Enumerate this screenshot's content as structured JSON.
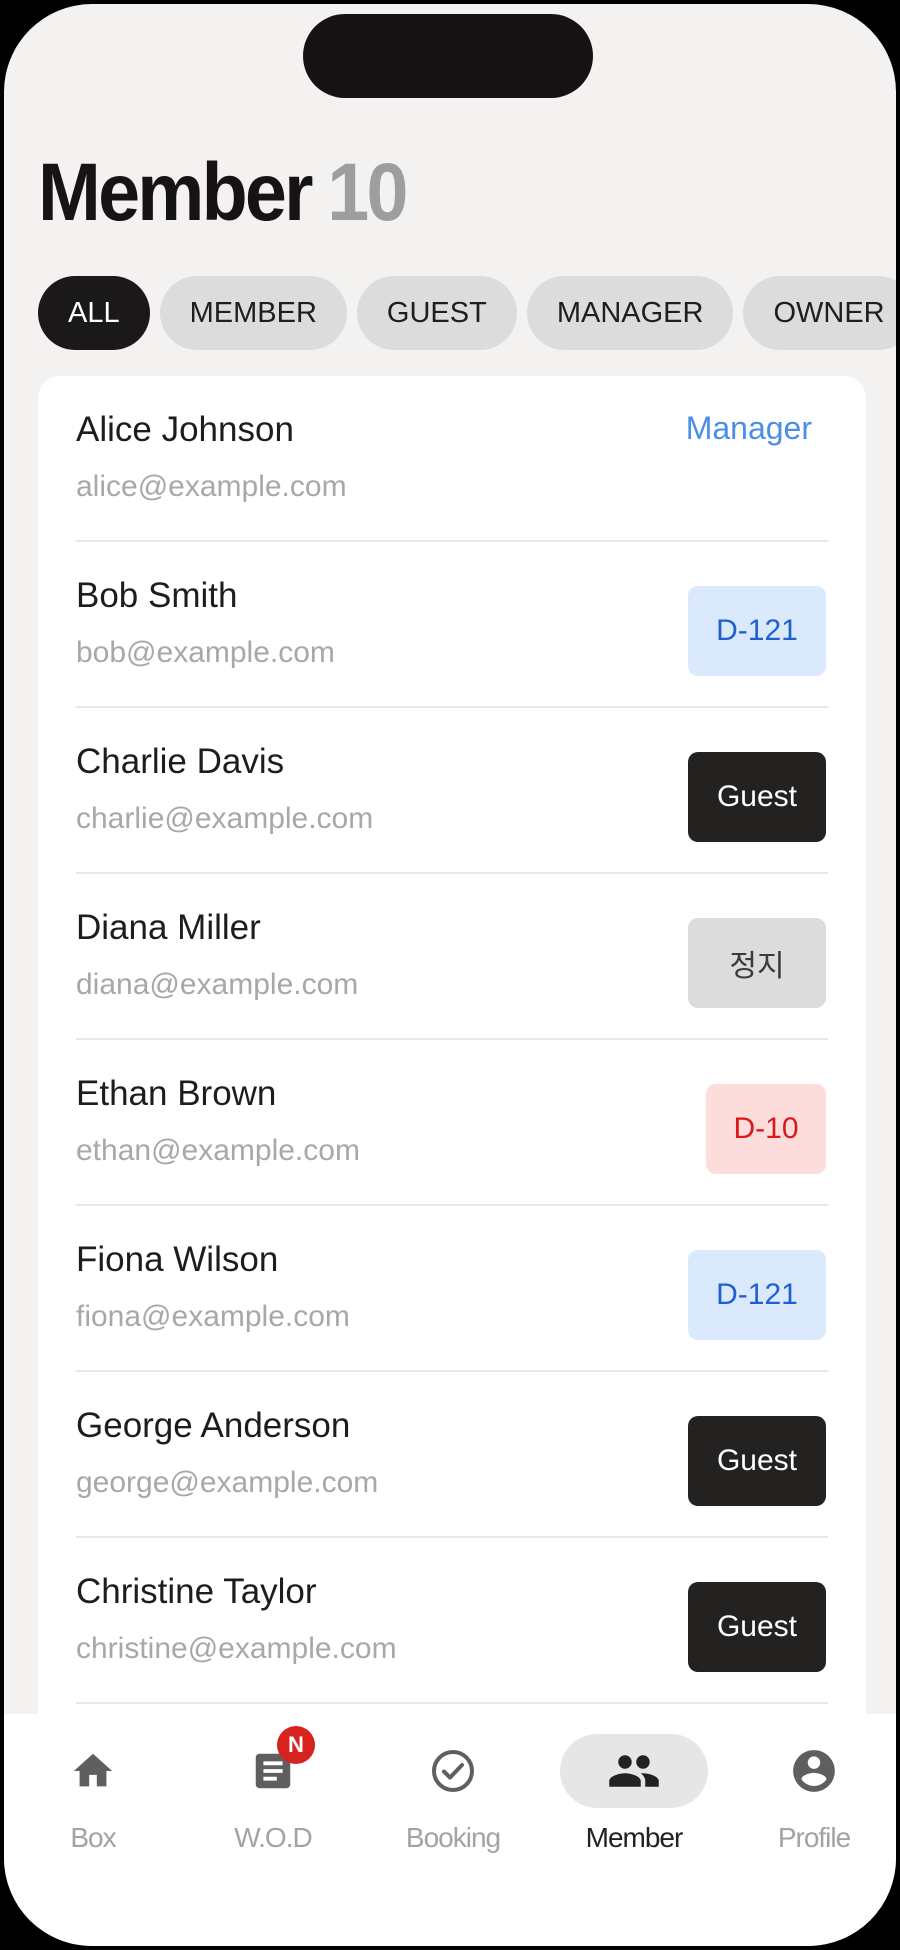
{
  "header": {
    "title": "Member",
    "count": "10"
  },
  "tabs": [
    {
      "label": "ALL",
      "active": true
    },
    {
      "label": "MEMBER",
      "active": false
    },
    {
      "label": "GUEST",
      "active": false
    },
    {
      "label": "MANAGER",
      "active": false
    },
    {
      "label": "OWNER",
      "active": false
    }
  ],
  "members": [
    {
      "name": "Alice Johnson",
      "email": "alice@example.com",
      "badge": "Manager",
      "badge_style": "role"
    },
    {
      "name": "Bob Smith",
      "email": "bob@example.com",
      "badge": "D-121",
      "badge_style": "blue"
    },
    {
      "name": "Charlie Davis",
      "email": "charlie@example.com",
      "badge": "Guest",
      "badge_style": "dark"
    },
    {
      "name": "Diana Miller",
      "email": "diana@example.com",
      "badge": "정지",
      "badge_style": "gray"
    },
    {
      "name": "Ethan Brown",
      "email": "ethan@example.com",
      "badge": "D-10",
      "badge_style": "red"
    },
    {
      "name": "Fiona Wilson",
      "email": "fiona@example.com",
      "badge": "D-121",
      "badge_style": "blue"
    },
    {
      "name": "George Anderson",
      "email": "george@example.com",
      "badge": "Guest",
      "badge_style": "dark"
    },
    {
      "name": "Christine Taylor",
      "email": "christine@example.com",
      "badge": "Guest",
      "badge_style": "dark"
    }
  ],
  "bottom_nav": {
    "items": [
      {
        "label": "Box",
        "icon": "home-icon",
        "active": false
      },
      {
        "label": "W.O.D",
        "icon": "article-icon",
        "active": false,
        "badge": "N"
      },
      {
        "label": "Booking",
        "icon": "check-circle-icon",
        "active": false
      },
      {
        "label": "Member",
        "icon": "people-icon",
        "active": true
      },
      {
        "label": "Profile",
        "icon": "account-circle-icon",
        "active": false
      }
    ]
  },
  "colors": {
    "background": "#f3f2f0",
    "accent_blue": "#4a8ee8",
    "badge_red": "#d91a1a",
    "dark": "#1a1818"
  }
}
